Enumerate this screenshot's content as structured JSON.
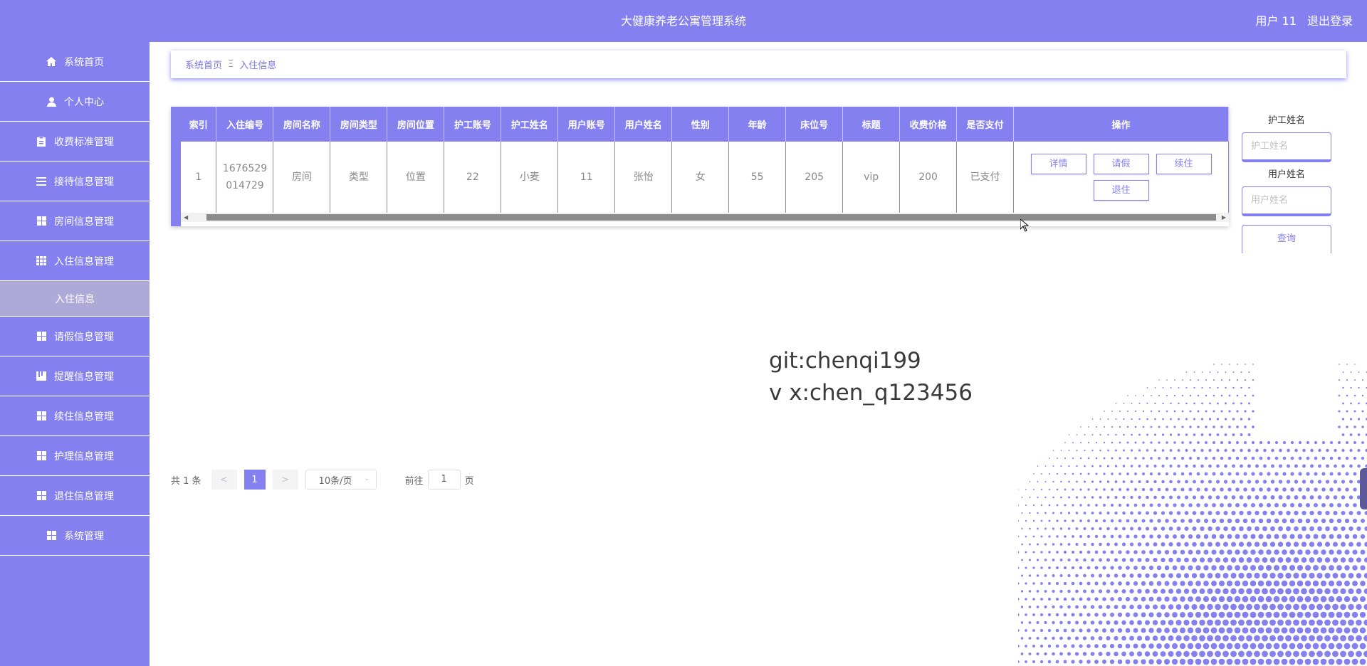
{
  "header": {
    "title": "大健康养老公寓管理系统",
    "user_label": "用户 11",
    "logout_label": "退出登录"
  },
  "sidebar": {
    "items": [
      {
        "label": "系统首页",
        "icon": "home-icon"
      },
      {
        "label": "个人中心",
        "icon": "user-icon"
      },
      {
        "label": "收费标准管理",
        "icon": "clipboard-icon"
      },
      {
        "label": "接待信息管理",
        "icon": "list-icon"
      },
      {
        "label": "房间信息管理",
        "icon": "grid-icon"
      },
      {
        "label": "入住信息管理",
        "icon": "table-icon"
      }
    ],
    "sub_item": "入住信息",
    "items2": [
      {
        "label": "请假信息管理",
        "icon": "grid-icon"
      },
      {
        "label": "提醒信息管理",
        "icon": "bookmark-icon"
      },
      {
        "label": "续住信息管理",
        "icon": "grid-icon"
      },
      {
        "label": "护理信息管理",
        "icon": "grid-icon"
      },
      {
        "label": "退住信息管理",
        "icon": "grid-icon"
      },
      {
        "label": "系统管理",
        "icon": "grid-icon"
      }
    ]
  },
  "breadcrumb": {
    "home": "系统首页",
    "sep": "Ξ",
    "current": "入住信息"
  },
  "table": {
    "headers": [
      "索引",
      "入住编号",
      "房间名称",
      "房间类型",
      "房间位置",
      "护工账号",
      "护工姓名",
      "用户账号",
      "用户姓名",
      "性别",
      "年龄",
      "床位号",
      "标题",
      "收费价格",
      "是否支付",
      "操作"
    ],
    "row": {
      "index": "1",
      "number_line1": "1676529",
      "number_line2": "014729",
      "room_name": "房间",
      "room_type": "类型",
      "room_location": "位置",
      "nurse_account": "22",
      "nurse_name": "小麦",
      "user_account": "11",
      "user_name": "张怡",
      "gender": "女",
      "age": "55",
      "bed": "205",
      "title": "vip",
      "price": "200",
      "paid": "已支付"
    },
    "actions": {
      "detail": "详情",
      "leave": "请假",
      "extend": "续住",
      "checkout": "退住"
    }
  },
  "search": {
    "nurse_label": "护工姓名",
    "nurse_placeholder": "护工姓名",
    "user_label": "用户姓名",
    "user_placeholder": "用户姓名",
    "query_label": "查询"
  },
  "pagination": {
    "total": "共 1 条",
    "prev": "<",
    "page": "1",
    "next": ">",
    "size": "10条/页",
    "goto_prefix": "前往",
    "goto_value": "1",
    "goto_suffix": "页"
  },
  "watermark": {
    "line1": "git:chenqi199",
    "line2": "v x:chen_q123456"
  },
  "colors": {
    "accent": "#8580f0",
    "sub_bg": "#aeaad8",
    "dots": "#8580f0"
  }
}
